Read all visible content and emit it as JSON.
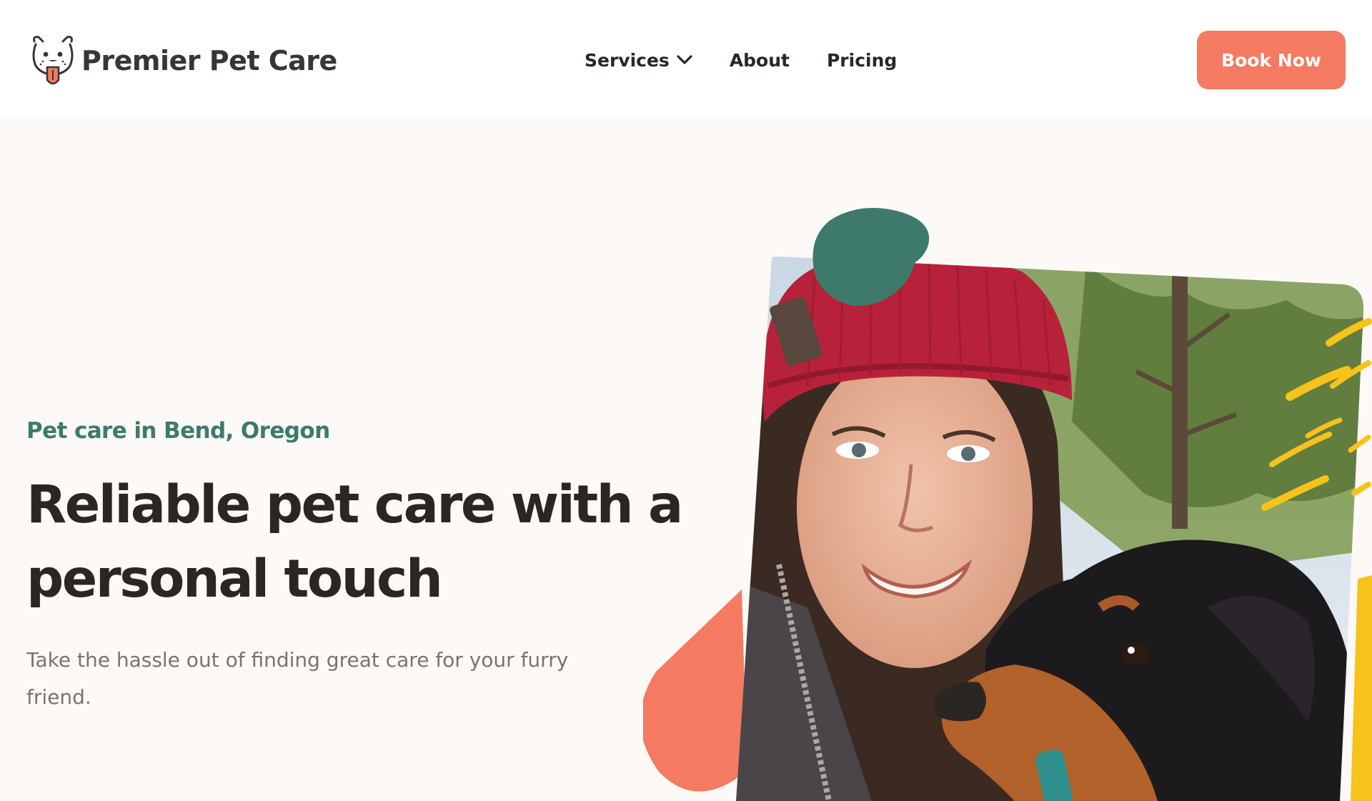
{
  "brand": {
    "name": "Premier Pet Care",
    "logo_icon": "dog-face-icon"
  },
  "nav": {
    "items": [
      {
        "label": "Services",
        "has_dropdown": true,
        "icon": "chevron-down-icon"
      },
      {
        "label": "About"
      },
      {
        "label": "Pricing"
      }
    ],
    "cta_label": "Book Now"
  },
  "hero": {
    "eyebrow": "Pet care in Bend, Oregon",
    "title": "Reliable pet care with a personal touch",
    "subtitle": "Take the hassle out of finding great care for your furry friend.",
    "photo_subject": "photo-woman-with-dog"
  },
  "colors": {
    "accent_coral": "#f47a62",
    "accent_green": "#3d7a6c",
    "accent_yellow": "#f7c21a",
    "text_dark": "#2b2523",
    "text_muted": "#7a7371",
    "background": "#fcf9f6"
  }
}
